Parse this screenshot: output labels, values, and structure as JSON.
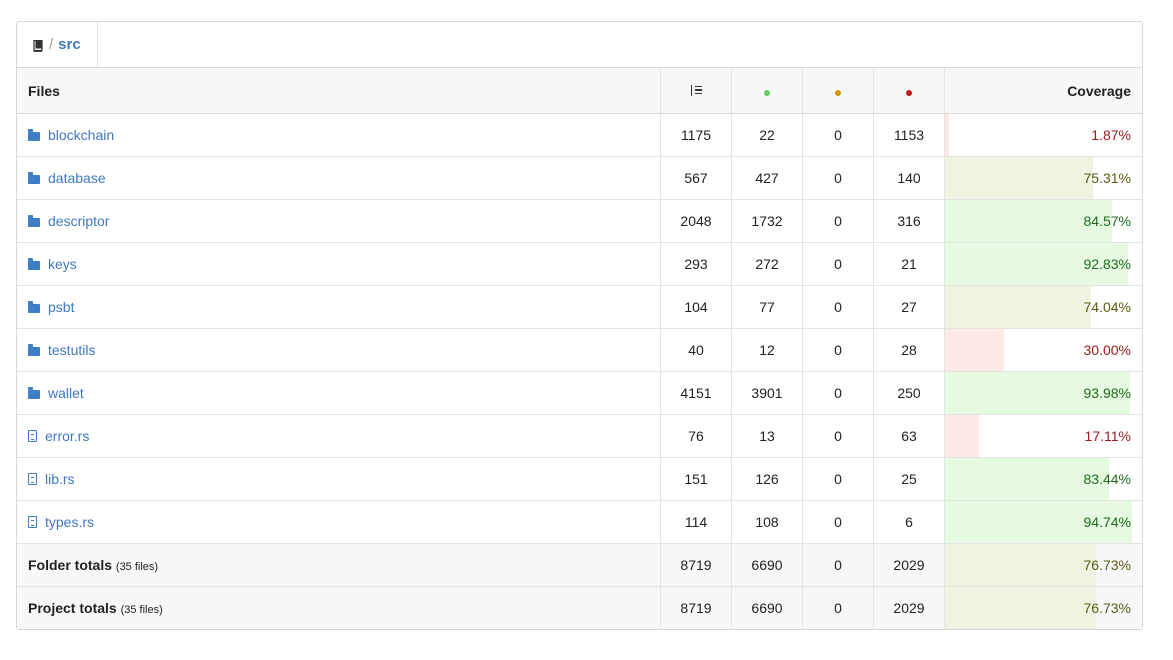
{
  "breadcrumb": {
    "home_icon": "book-icon",
    "separator": "/",
    "current": "src"
  },
  "header": {
    "files_label": "Files",
    "lines_icon": "list-lines-icon",
    "covered_icon": "green-dot-icon",
    "partial_icon": "yellow-dot-icon",
    "missed_icon": "red-dot-icon",
    "coverage_label": "Coverage"
  },
  "colors": {
    "covered": "#5fd15f",
    "partial": "#d4930a",
    "missed": "#c21a1a",
    "link": "#4078c0",
    "high": "#e6f9e1",
    "mid": "#eff4e1",
    "low": "#fde9e6",
    "high_text": "#1e6b1e",
    "mid_text": "#5a5a14",
    "low_text": "#9a1a1a"
  },
  "rows": [
    {
      "type": "folder",
      "icon": "folder-icon",
      "name": "blockchain",
      "lines": "1175",
      "hits": "22",
      "partial": "0",
      "misses": "1153",
      "coverage": "1.87%",
      "pct": 1.87
    },
    {
      "type": "folder",
      "icon": "folder-icon",
      "name": "database",
      "lines": "567",
      "hits": "427",
      "partial": "0",
      "misses": "140",
      "coverage": "75.31%",
      "pct": 75.31
    },
    {
      "type": "folder",
      "icon": "folder-icon",
      "name": "descriptor",
      "lines": "2048",
      "hits": "1732",
      "partial": "0",
      "misses": "316",
      "coverage": "84.57%",
      "pct": 84.57
    },
    {
      "type": "folder",
      "icon": "folder-icon",
      "name": "keys",
      "lines": "293",
      "hits": "272",
      "partial": "0",
      "misses": "21",
      "coverage": "92.83%",
      "pct": 92.83
    },
    {
      "type": "folder",
      "icon": "folder-icon",
      "name": "psbt",
      "lines": "104",
      "hits": "77",
      "partial": "0",
      "misses": "27",
      "coverage": "74.04%",
      "pct": 74.04
    },
    {
      "type": "folder",
      "icon": "folder-icon",
      "name": "testutils",
      "lines": "40",
      "hits": "12",
      "partial": "0",
      "misses": "28",
      "coverage": "30.00%",
      "pct": 30.0
    },
    {
      "type": "folder",
      "icon": "folder-icon",
      "name": "wallet",
      "lines": "4151",
      "hits": "3901",
      "partial": "0",
      "misses": "250",
      "coverage": "93.98%",
      "pct": 93.98
    },
    {
      "type": "file",
      "icon": "file-icon",
      "name": "error.rs",
      "lines": "76",
      "hits": "13",
      "partial": "0",
      "misses": "63",
      "coverage": "17.11%",
      "pct": 17.11
    },
    {
      "type": "file",
      "icon": "file-icon",
      "name": "lib.rs",
      "lines": "151",
      "hits": "126",
      "partial": "0",
      "misses": "25",
      "coverage": "83.44%",
      "pct": 83.44
    },
    {
      "type": "file",
      "icon": "file-icon",
      "name": "types.rs",
      "lines": "114",
      "hits": "108",
      "partial": "0",
      "misses": "6",
      "coverage": "94.74%",
      "pct": 94.74
    }
  ],
  "totals": [
    {
      "label": "Folder totals",
      "count": "(35 files)",
      "lines": "8719",
      "hits": "6690",
      "partial": "0",
      "misses": "2029",
      "coverage": "76.73%",
      "pct": 76.73
    },
    {
      "label": "Project totals",
      "count": "(35 files)",
      "lines": "8719",
      "hits": "6690",
      "partial": "0",
      "misses": "2029",
      "coverage": "76.73%",
      "pct": 76.73
    }
  ]
}
